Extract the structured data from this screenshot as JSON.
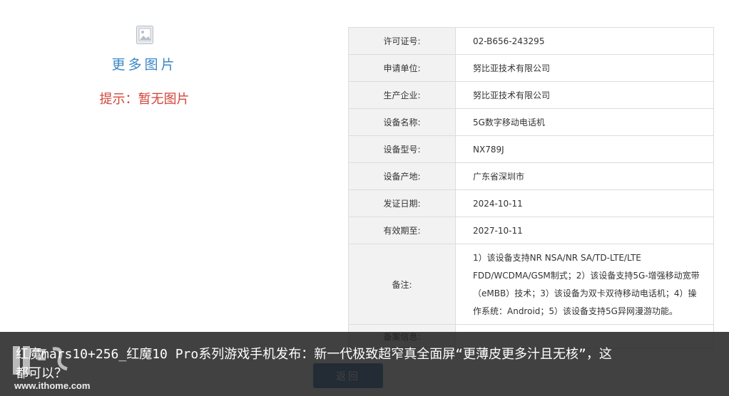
{
  "gallery": {
    "more_label": "更多图片",
    "tip": "提示：暂无图片"
  },
  "info_rows": [
    {
      "label": "许可证号:",
      "value": "02-B656-243295"
    },
    {
      "label": "申请单位:",
      "value": "努比亚技术有限公司"
    },
    {
      "label": "生产企业:",
      "value": "努比亚技术有限公司"
    },
    {
      "label": "设备名称:",
      "value": "5G数字移动电话机"
    },
    {
      "label": "设备型号:",
      "value": "NX789J"
    },
    {
      "label": "设备产地:",
      "value": "广东省深圳市"
    },
    {
      "label": "发证日期:",
      "value": "2024-10-11"
    },
    {
      "label": "有效期至:",
      "value": "2027-10-11"
    },
    {
      "label": "备注:",
      "value": "1）该设备支持NR NSA/NR SA/TD-LTE/LTE FDD/WCDMA/GSM制式；2）该设备支持5G-增强移动宽带（eMBB）技术；3）该设备为双卡双待移动电话机；4）操作系统：Android；5）该设备支持5G异网漫游功能。"
    },
    {
      "label": "备案信息:",
      "value": ""
    }
  ],
  "back_button": "返回",
  "overlay": {
    "title": "红魔mars10+256_红魔10 Pro系列游戏手机发布：新一代极致超窄真全面屏“更薄皮更多汁且无核”，这都可以？",
    "watermark_url": "www.ithome.com"
  },
  "icons": {
    "image_placeholder": "image-placeholder-icon",
    "watermark": "ithome-logo"
  }
}
